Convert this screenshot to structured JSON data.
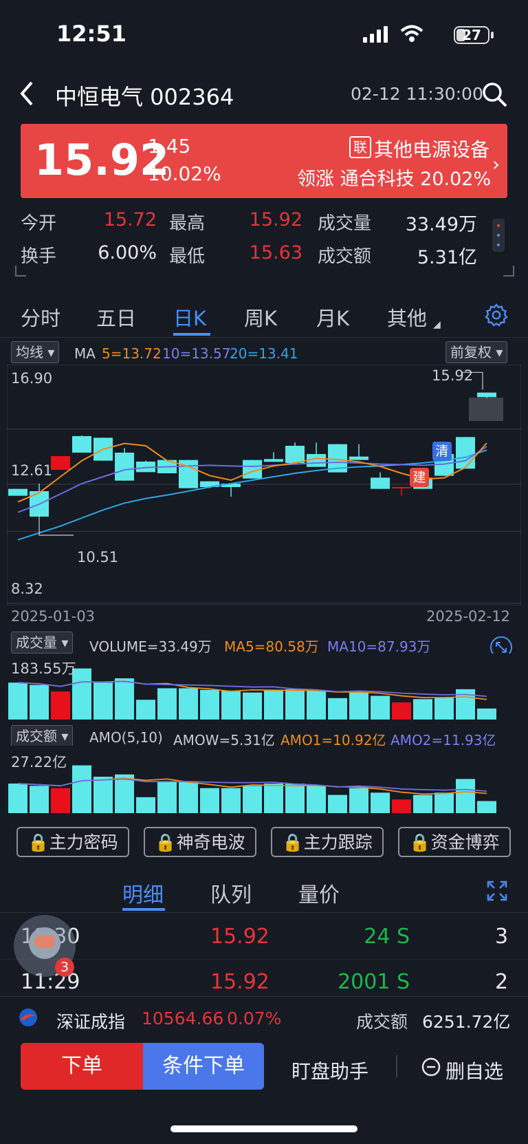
{
  "status_bar": {
    "time": "12:51",
    "battery": "27"
  },
  "header": {
    "stock_title": "中恒电气 002364",
    "timestamp": "02-12 11:30:00"
  },
  "price_card": {
    "price": "15.92",
    "change": "1.45",
    "change_pct": "10.02%",
    "lian_badge": "联",
    "sector": "其他电源设备",
    "lead_text": "领涨 通合科技 20.02%"
  },
  "stats": [
    {
      "label": "今开",
      "value": "15.72"
    },
    {
      "label": "最高",
      "value": "15.92"
    },
    {
      "label": "成交量",
      "value": "33.49万"
    },
    {
      "label": "换手",
      "value": "6.00%"
    },
    {
      "label": "最低",
      "value": "15.63"
    },
    {
      "label": "成交额",
      "value": "5.31亿"
    }
  ],
  "tabs": [
    "分时",
    "五日",
    "日K",
    "周K",
    "月K",
    "其他"
  ],
  "kline": {
    "ma_dropdown": "均线",
    "ma_label": "MA",
    "ma5": "5=13.72",
    "ma10": "10=13.57",
    "ma20": "20=13.41",
    "adjust": "前复权",
    "price_top": "16.90",
    "price_mid": "12.61",
    "price_bottom": "8.32",
    "high_mark": "15.92",
    "low_mark": "10.51",
    "date_start": "2025-01-03",
    "date_end": "2025-02-12",
    "marker_build": "建",
    "marker_clear": "清",
    "colors": {
      "up": "#e8101a",
      "down": "#5ee8ea",
      "ma5": "#ef8c1a",
      "ma10": "#6a6ee0",
      "ma20": "#2fa6e6"
    }
  },
  "volume": {
    "dropdown": "成交量",
    "volume_text": "VOLUME=33.49万",
    "ma5_text": "MA5=80.58万",
    "ma10_text": "MA10=87.93万",
    "max_label": "183.55万"
  },
  "amount": {
    "dropdown": "成交额",
    "amo_text": "AMO(5,10)",
    "amow_text": "AMOW=5.31亿",
    "amo1_text": "AMO1=10.92亿",
    "amo2_text": "AMO2=11.93亿",
    "max_label": "27.22亿"
  },
  "chart_data": {
    "type": "candlestick",
    "ylim": [
      8.32,
      16.9
    ],
    "ohlc": [
      [
        11.72,
        11.72,
        11.45,
        11.42
      ],
      [
        11.62,
        11.95,
        10.51,
        10.51
      ],
      [
        12.55,
        13.15,
        12.55,
        13.15
      ],
      [
        14.02,
        14.05,
        13.3,
        13.3
      ],
      [
        13.95,
        13.95,
        12.95,
        12.95
      ],
      [
        13.3,
        13.5,
        12.08,
        12.08
      ],
      [
        12.91,
        12.95,
        12.91,
        12.45
      ],
      [
        12.98,
        12.98,
        12.4,
        12.4
      ],
      [
        12.98,
        12.98,
        11.75,
        11.75
      ],
      [
        12.05,
        12.05,
        11.75,
        11.8
      ],
      [
        11.95,
        11.95,
        11.38,
        11.8
      ],
      [
        12.98,
        12.98,
        12.17,
        12.17
      ],
      [
        13.02,
        13.32,
        12.9,
        12.9
      ],
      [
        13.6,
        13.74,
        13.6,
        12.85
      ],
      [
        13.24,
        13.74,
        13.24,
        12.68
      ],
      [
        13.67,
        13.67,
        12.44,
        12.44
      ],
      [
        13.13,
        13.67,
        12.98,
        12.98
      ],
      [
        12.21,
        12.44,
        11.72,
        11.72
      ],
      [
        11.8,
        11.82,
        11.42,
        11.8
      ],
      [
        12.21,
        12.44,
        11.72,
        11.72
      ],
      [
        13.24,
        13.24,
        12.29,
        12.29
      ],
      [
        13.98,
        13.98,
        12.6,
        12.6
      ],
      [
        15.92,
        15.92,
        15.63,
        15.72
      ]
    ],
    "ma5": [
      11.15,
      11.55,
      12.25,
      12.95,
      13.45,
      13.7,
      13.6,
      12.95,
      12.7,
      12.3,
      12.1,
      12.48,
      12.72,
      12.85,
      13.05,
      13.0,
      12.9,
      12.7,
      12.4,
      12.15,
      12.2,
      12.65,
      13.72
    ],
    "ma10": [
      10.7,
      11.05,
      11.5,
      11.95,
      12.25,
      12.55,
      12.65,
      12.68,
      12.72,
      12.75,
      12.72,
      12.7,
      12.75,
      12.8,
      12.85,
      12.88,
      12.85,
      12.8,
      12.78,
      12.75,
      12.8,
      12.95,
      13.57
    ],
    "ma20": [
      9.5,
      9.8,
      10.1,
      10.45,
      10.8,
      11.1,
      11.3,
      11.45,
      11.62,
      11.8,
      11.95,
      12.1,
      12.25,
      12.4,
      12.52,
      12.62,
      12.68,
      12.72,
      12.78,
      12.85,
      12.95,
      13.1,
      13.41
    ],
    "volume": [
      112,
      105,
      85,
      155,
      112,
      125,
      60,
      95,
      95,
      90,
      88,
      82,
      90,
      92,
      88,
      65,
      82,
      72,
      52,
      62,
      66,
      92,
      33.49
    ],
    "amount": [
      13,
      12,
      11,
      21,
      16,
      17,
      7,
      14,
      14,
      11,
      11,
      12,
      13,
      13,
      12,
      8,
      11,
      9,
      6,
      8,
      9,
      15,
      5.31
    ]
  },
  "feature_buttons": [
    "主力密码",
    "神奇电波",
    "主力跟踪",
    "资金博弈"
  ],
  "detail_tabs": [
    "明细",
    "队列",
    "量价"
  ],
  "trades": [
    {
      "time": "11:30",
      "price": "15.92",
      "vol": "24 S",
      "count": "3"
    },
    {
      "time": "11:29",
      "price": "15.92",
      "vol": "2001 S",
      "count": "2"
    }
  ],
  "assistant_badge": "3",
  "index_bar": {
    "name": "深证成指",
    "value": "10564.66",
    "pct": "0.07%",
    "amount_label": "成交额",
    "amount": "6251.72亿"
  },
  "actions": {
    "order": "下单",
    "cond_order": "条件下单",
    "watch": "盯盘助手",
    "remove": "删自选"
  }
}
